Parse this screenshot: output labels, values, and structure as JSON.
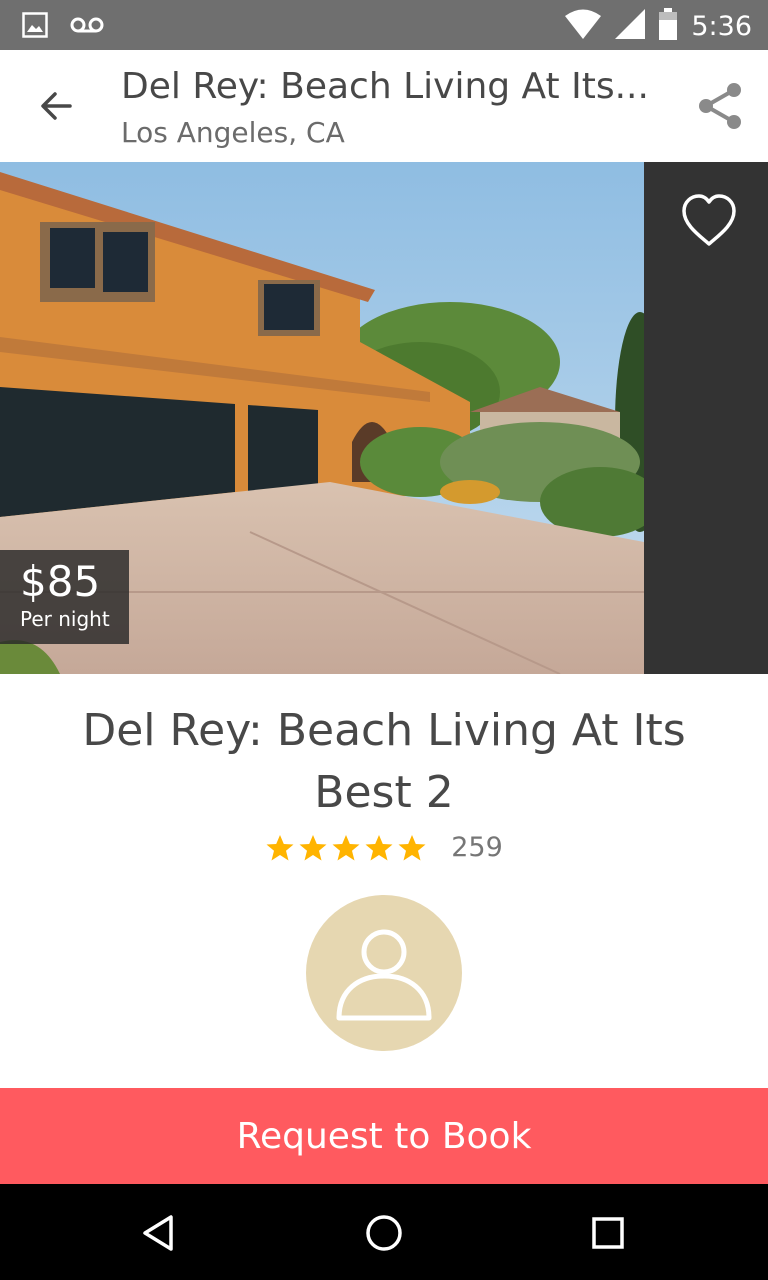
{
  "status_bar": {
    "time": "5:36",
    "icons": [
      "image-notification-icon",
      "voicemail-icon",
      "wifi-icon",
      "cell-signal-icon",
      "battery-icon"
    ]
  },
  "header": {
    "title": "Del Rey: Beach Living At Its...",
    "subtitle": "Los Angeles, CA",
    "back_icon": "arrow-left-icon",
    "share_icon": "share-icon"
  },
  "hero": {
    "price": "$85",
    "price_unit": "Per night",
    "favorite_icon": "heart-outline-icon"
  },
  "listing": {
    "title": "Del Rey: Beach Living At Its Best 2",
    "rating_stars": 5,
    "reviews": "259",
    "host_avatar_icon": "person-icon"
  },
  "actions": {
    "book_label": "Request to Book"
  },
  "colors": {
    "accent": "#ff5a5f",
    "star": "#ffb400",
    "avatar_bg": "#e6d7b1",
    "status_bar": "#6f6f6f"
  },
  "nav_bar": {
    "icons": [
      "back-triangle-icon",
      "home-circle-icon",
      "recents-square-icon"
    ]
  }
}
